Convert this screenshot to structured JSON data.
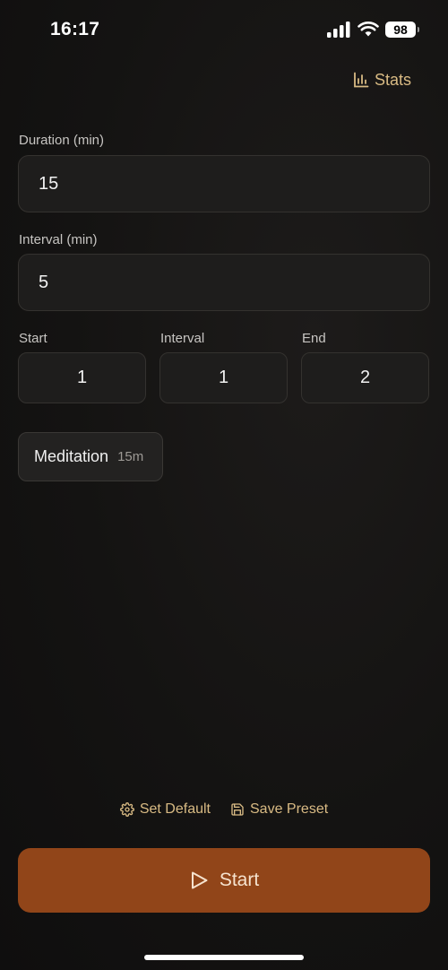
{
  "status_bar": {
    "time": "16:17",
    "battery": "98"
  },
  "header": {
    "stats_label": "Stats",
    "stats_icon": "bar-chart-icon"
  },
  "duration": {
    "label": "Duration (min)",
    "value": "15"
  },
  "interval": {
    "label": "Interval (min)",
    "value": "5"
  },
  "bells": {
    "start_label": "Start",
    "start_value": "1",
    "interval_label": "Interval",
    "interval_value": "1",
    "end_label": "End",
    "end_value": "2"
  },
  "presets": [
    {
      "name": "Meditation",
      "duration": "15m"
    }
  ],
  "actions": {
    "set_default_label": "Set Default",
    "set_default_icon": "gear-icon",
    "save_preset_label": "Save Preset",
    "save_preset_icon": "floppy-disk-icon"
  },
  "start": {
    "label": "Start",
    "icon": "play-icon"
  },
  "colors": {
    "accent": "#d9bb84",
    "start_button": "#914519",
    "background": "#141312",
    "field": "#1e1d1c"
  }
}
